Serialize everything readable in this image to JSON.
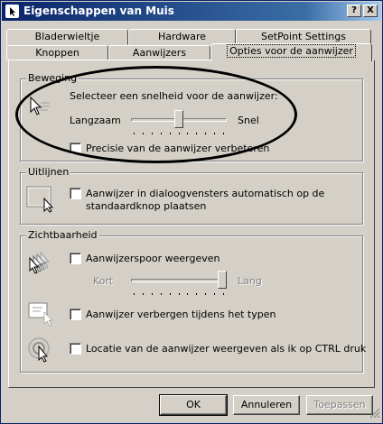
{
  "window": {
    "title": "Eigenschappen van Muis",
    "help_label": "?",
    "close_label": "X"
  },
  "tabs": {
    "row1": [
      "Bladerwieltje",
      "Hardware",
      "SetPoint Settings"
    ],
    "row2": [
      "Knoppen",
      "Aanwijzers",
      "Opties voor de aanwijzer"
    ],
    "selected": "Opties voor de aanwijzer"
  },
  "beweging": {
    "label": "Beweging",
    "prompt": "Selecteer een snelheid voor de aanwijzer:",
    "slow_label": "Langzaam",
    "fast_label": "Snel",
    "speed_level": 0.5,
    "precision_label": "Precisie van de aanwijzer verbeteren",
    "precision_checked": false
  },
  "uitlijnen": {
    "label": "Uitlijnen",
    "snap_line1": "Aanwijzer in dialoogvensters automatisch op de",
    "snap_line2": "standaardknop plaatsen",
    "snap_checked": false
  },
  "zichtbaarheid": {
    "label": "Zichtbaarheid",
    "trail_label": "Aanwijzerspoor weergeven",
    "trail_checked": false,
    "short_label": "Kort",
    "long_label": "Lang",
    "trail_level": 1.0,
    "hide_label": "Aanwijzer verbergen tijdens het typen",
    "hide_checked": false,
    "ctrl_label": "Locatie van de aanwijzer weergeven als ik op CTRL druk",
    "ctrl_checked": false
  },
  "buttons": {
    "ok": "OK",
    "cancel": "Annuleren",
    "apply": "Toepassen"
  },
  "colors": {
    "title_active": "#0a246a",
    "face": "#d4d0c8"
  }
}
